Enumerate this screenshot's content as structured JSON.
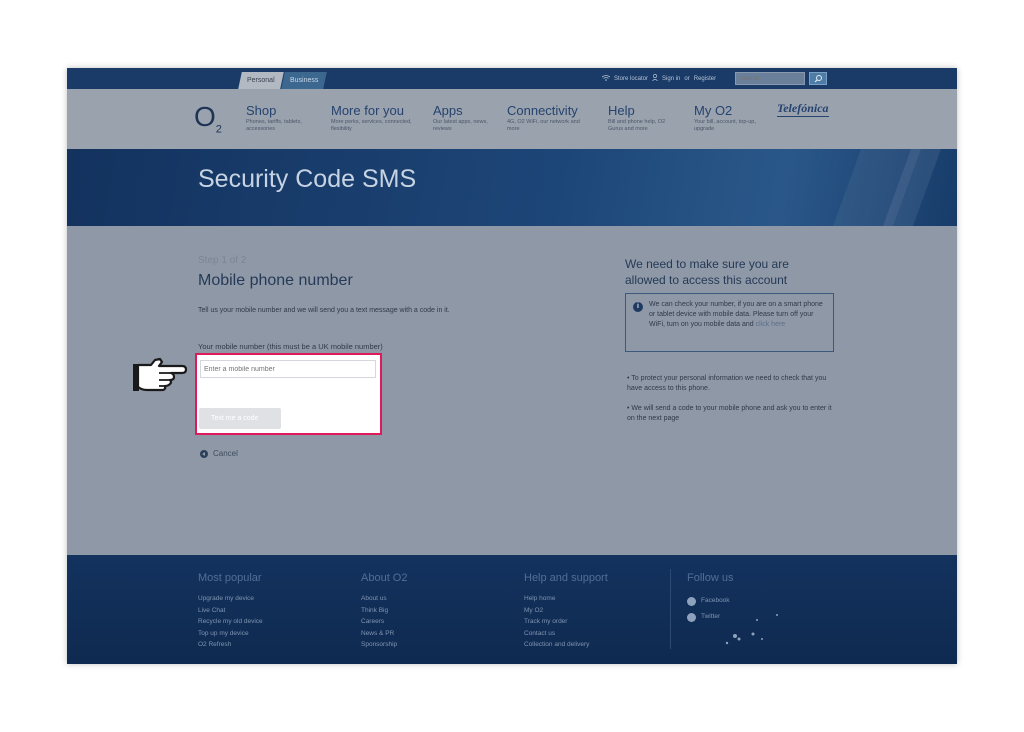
{
  "topbar": {
    "tabs": [
      {
        "label": "Personal"
      },
      {
        "label": "Business"
      }
    ],
    "store_locator": "Store locator",
    "sign_in": "Sign in",
    "or": "or",
    "register": "Register",
    "search_placeholder": "Search"
  },
  "nav": {
    "logo": "O",
    "logo_sub": "2",
    "items": [
      {
        "title": "Shop",
        "desc": "Phones, tariffs, tablets, accessories"
      },
      {
        "title": "More for you",
        "desc": "More perks, services, connected, flexibility"
      },
      {
        "title": "Apps",
        "desc": "Our latest apps, news, reviews"
      },
      {
        "title": "Connectivity",
        "desc": "4G, O2 WiFi, our network and more"
      },
      {
        "title": "Help",
        "desc": "Bill and phone help, O2 Gurus and more"
      },
      {
        "title": "My O2",
        "desc": "Your bill, account, top-up, upgrade"
      }
    ],
    "brand": "Telefónica"
  },
  "hero": {
    "title": "Security Code SMS"
  },
  "form": {
    "step": "Step 1 of 2",
    "title": "Mobile phone number",
    "intro": "Tell us your mobile number and we will send you a text message with a code in it.",
    "field_label": "Your mobile number (this must be a UK mobile number)",
    "field_placeholder": "Enter a mobile number",
    "submit_label": "Text me a code",
    "cancel_label": "Cancel"
  },
  "aside": {
    "title": "We need to make sure you are allowed to access this account",
    "info_text": "We can check your number, if you are on a smart phone or tablet device with mobile data. Please turn off your WiFi, turn on you mobile data and ",
    "info_link": "click here",
    "bullets": [
      "To protect your personal information we need to check that you have access to this phone.",
      "We will send a code to your mobile phone and ask you to enter it on the next page"
    ]
  },
  "footer": {
    "columns": [
      {
        "heading": "Most popular",
        "links": [
          "Upgrade my device",
          "Live Chat",
          "Recycle my old device",
          "Top up my device",
          "O2 Refresh"
        ]
      },
      {
        "heading": "About O2",
        "links": [
          "About us",
          "Think Big",
          "Careers",
          "News & PR",
          "Sponsorship"
        ]
      },
      {
        "heading": "Help and support",
        "links": [
          "Help home",
          "My O2",
          "Track my order",
          "Contact us",
          "Collection and delivery"
        ]
      }
    ],
    "follow": {
      "heading": "Follow us",
      "links": [
        "Facebook",
        "Twitter"
      ]
    }
  },
  "colors": {
    "highlight_border": "#e0195a",
    "brand_navy": "#13325e"
  }
}
